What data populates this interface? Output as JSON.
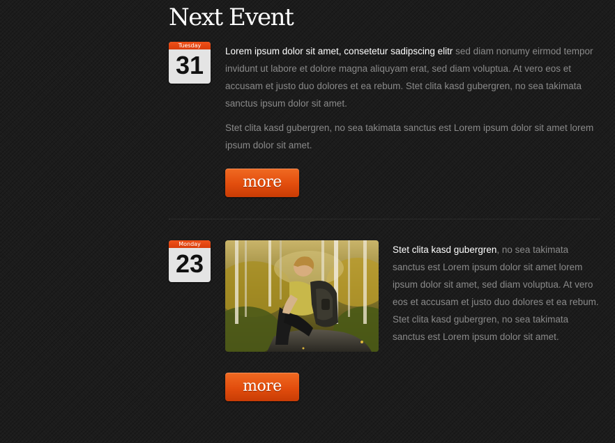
{
  "heading": "Next Event",
  "colors": {
    "background": "#1c1c1c",
    "accent": "#e24d0d",
    "text_muted": "#8a8a8a",
    "text_lead": "#ffffff"
  },
  "events": [
    {
      "day": "Tuesday",
      "date": "31",
      "paragraphs": [
        {
          "lead": "Lorem ipsum dolor sit amet, consetetur sadipscing elitr",
          "text": " sed diam nonumy eirmod tempor invidunt ut labore et dolore magna aliquyam erat, sed diam voluptua. At vero eos et accusam et justo duo dolores et ea rebum. Stet clita kasd gubergren, no sea takimata sanctus ipsum dolor sit amet."
        },
        {
          "text": "Stet clita kasd gubergren, no sea takimata sanctus est Lorem ipsum dolor sit amet lorem ipsum dolor sit amet."
        }
      ],
      "more_label": "more"
    },
    {
      "day": "Monday",
      "date": "23",
      "image": {
        "icon": "photo-boy-with-backpack-in-forest"
      },
      "paragraphs": [
        {
          "lead": "Stet clita kasd gubergren",
          "text": ", no sea takimata sanctus est Lorem ipsum dolor sit amet lorem ipsum dolor sit amet, sed diam voluptua. At vero eos et accusam et justo duo dolores et ea rebum. Stet clita kasd gubergren, no sea takimata sanctus est Lorem ipsum dolor sit amet."
        }
      ],
      "more_label": "more"
    }
  ]
}
